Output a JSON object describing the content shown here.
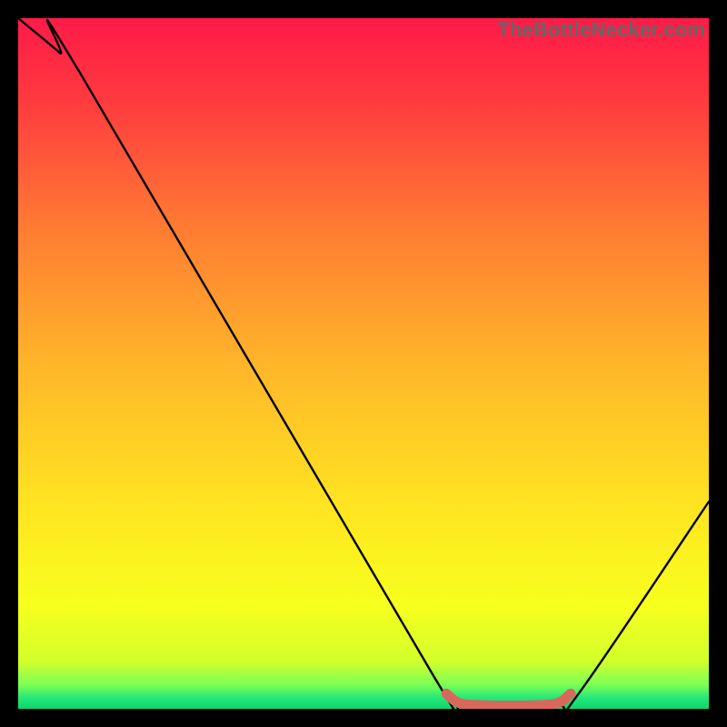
{
  "watermark": "TheBottleNecker.com",
  "chart_data": {
    "type": "line",
    "title": "",
    "xlabel": "",
    "ylabel": "",
    "xlim": [
      0,
      100
    ],
    "ylim": [
      0,
      100
    ],
    "series": [
      {
        "name": "curve",
        "points": [
          [
            0,
            100
          ],
          [
            6,
            95
          ],
          [
            9,
            92
          ],
          [
            60,
            5
          ],
          [
            63,
            2
          ],
          [
            66,
            0.5
          ],
          [
            78,
            0.5
          ],
          [
            81,
            2
          ],
          [
            100,
            30
          ]
        ]
      }
    ],
    "highlight": {
      "name": "flat-segment",
      "points": [
        [
          62,
          2.2
        ],
        [
          64,
          0.8
        ],
        [
          68,
          0.5
        ],
        [
          74,
          0.5
        ],
        [
          78,
          0.8
        ],
        [
          80,
          2.2
        ]
      ]
    },
    "gradient_stops": [
      {
        "offset": 0.0,
        "color": "#ff1a48"
      },
      {
        "offset": 0.12,
        "color": "#ff3a3f"
      },
      {
        "offset": 0.3,
        "color": "#ff7a33"
      },
      {
        "offset": 0.5,
        "color": "#ffb52a"
      },
      {
        "offset": 0.7,
        "color": "#ffe321"
      },
      {
        "offset": 0.85,
        "color": "#f7ff1e"
      },
      {
        "offset": 0.93,
        "color": "#d4ff2a"
      },
      {
        "offset": 0.965,
        "color": "#7dff55"
      },
      {
        "offset": 0.985,
        "color": "#22e77a"
      },
      {
        "offset": 1.0,
        "color": "#0fd66a"
      }
    ]
  }
}
